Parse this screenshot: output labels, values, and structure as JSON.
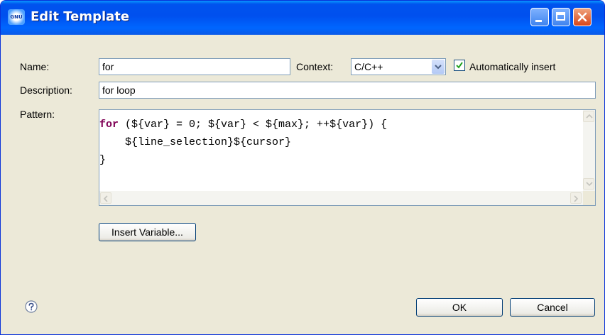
{
  "window": {
    "title": "Edit Template",
    "app_icon_text": "GNU"
  },
  "form": {
    "name_label": "Name:",
    "name_value": "for",
    "context_label": "Context:",
    "context_value": "C/C++",
    "auto_insert_label": "Automatically insert",
    "auto_insert_checked": true,
    "description_label": "Description:",
    "description_value": "for loop",
    "pattern_label": "Pattern:",
    "pattern_lines": [
      {
        "keyword": "for",
        "rest": " (${var} = 0; ${var} < ${max}; ++${var}) {"
      },
      {
        "keyword": "",
        "rest": "    ${line_selection}${cursor}"
      },
      {
        "keyword": "",
        "rest": "}"
      }
    ]
  },
  "buttons": {
    "insert_variable": "Insert Variable...",
    "ok": "OK",
    "cancel": "Cancel"
  },
  "icons": {
    "help": "help-icon",
    "minimize": "minimize-icon",
    "maximize": "maximize-icon",
    "close": "close-icon"
  },
  "colors": {
    "titlebar": "#0053ee",
    "keyword": "#7f0055",
    "dialog_bg": "#ece9d8"
  }
}
